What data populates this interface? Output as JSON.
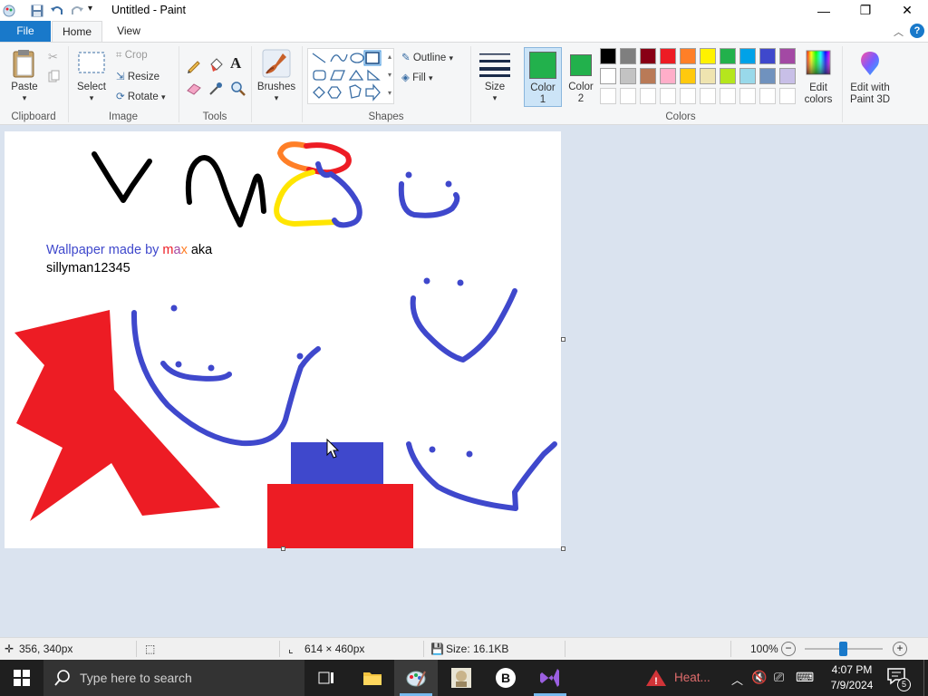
{
  "window": {
    "title": "Untitled - Paint"
  },
  "tabs": {
    "file": "File",
    "home": "Home",
    "view": "View"
  },
  "clipboard": {
    "paste": "Paste",
    "group": "Clipboard"
  },
  "image": {
    "select": "Select",
    "crop": "Crop",
    "resize": "Resize",
    "rotate": "Rotate",
    "group": "Image"
  },
  "tools": {
    "group": "Tools"
  },
  "brushes": {
    "label": "Brushes"
  },
  "shapes": {
    "outline": "Outline",
    "fill": "Fill",
    "group": "Shapes"
  },
  "size": {
    "label": "Size"
  },
  "colors": {
    "color1_label": "Color",
    "color1_num": "1",
    "color2_label": "Color",
    "color2_num": "2",
    "edit_colors_1": "Edit",
    "edit_colors_2": "colors",
    "paint3d_1": "Edit with",
    "paint3d_2": "Paint 3D",
    "group": "Colors",
    "color1_value": "#22b14c",
    "color2_value": "#22b14c",
    "palette_row1": [
      "#000000",
      "#7f7f7f",
      "#880015",
      "#ed1c24",
      "#ff7f27",
      "#fff200",
      "#22b14c",
      "#00a2e8",
      "#3f48cc",
      "#a349a4"
    ],
    "palette_row2": [
      "#ffffff",
      "#c3c3c3",
      "#b97a57",
      "#ffaec9",
      "#ffc90e",
      "#efe4b0",
      "#b5e61d",
      "#99d9ea",
      "#7092be",
      "#c8bfe7"
    ]
  },
  "canvas_text": {
    "line1_a": "Wallpaper made by ",
    "line1_m": "m",
    "line1_a2": "a",
    "line1_x": "x",
    "line1_aka": " aka",
    "line2": "sillyman12345"
  },
  "status": {
    "cursor_pos": "356, 340px",
    "dimensions": "614 × 460px",
    "size": "Size: 16.1KB",
    "zoom": "100%"
  },
  "taskbar": {
    "search_placeholder": "Type here to search",
    "heat_label": "Heat...",
    "time": "4:07 PM",
    "date": "7/9/2024",
    "notif_count": "5"
  }
}
